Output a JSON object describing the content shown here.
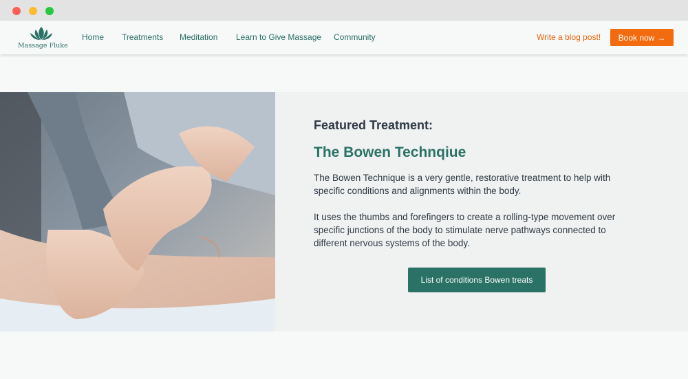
{
  "nav": {
    "logo_text": "Massage Fluke",
    "links": [
      "Home",
      "Treatments",
      "Meditation",
      "Learn to Give Massage",
      "Community"
    ],
    "blog_label": "Write a blog post!",
    "book_label": "Book now",
    "book_icon": "arrow-right-icon"
  },
  "featured": {
    "eyebrow": "Featured Treatment:",
    "title": "The Bowen Technqiue",
    "paragraph1": "The Bowen Technique is a very gentle, restorative treatment to help with specific conditions and alignments within the body.",
    "paragraph2": "It uses the thumbs and forefingers to create a rolling-type movement over specific junctions of the body to stimulate nerve pathways connected to different nervous systems of the body.",
    "cta_label": "List of conditions Bowen treats"
  },
  "colors": {
    "brand_teal": "#2a7266",
    "accent_orange": "#f26b0f"
  }
}
